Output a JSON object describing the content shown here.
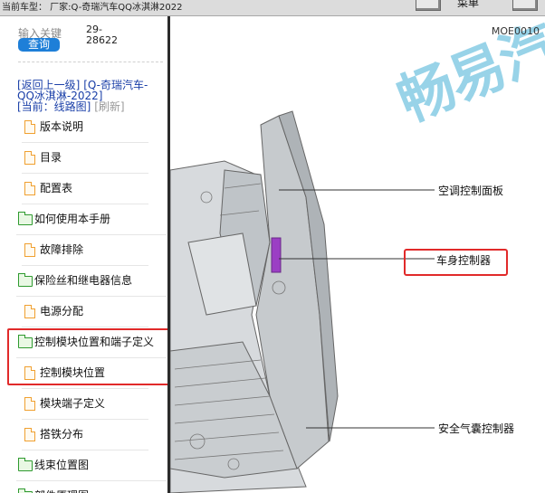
{
  "topbar": {
    "current_model": "当前车型：  厂家:Q-奇瑞汽车QQ冰淇淋2022",
    "right_label": "菜单"
  },
  "sidebar": {
    "search_placeholder": "输入关键",
    "query_button": "查询",
    "code_text": "29-28622",
    "back_link": "[返回上一级]",
    "parent_title": "[Q-奇瑞汽车-QQ冰淇淋-2022]",
    "current_label": "[当前：线路图]",
    "refresh_link": "[刷新]",
    "items": [
      {
        "label": "版本说明",
        "type": "file"
      },
      {
        "label": "目录",
        "type": "file"
      },
      {
        "label": "配置表",
        "type": "file"
      },
      {
        "label": "如何使用本手册",
        "type": "folder"
      },
      {
        "label": "故障排除",
        "type": "file"
      },
      {
        "label": "保险丝和继电器信息",
        "type": "folder"
      },
      {
        "label": "电源分配",
        "type": "file"
      },
      {
        "label": "控制模块位置和端子定义",
        "type": "folder"
      },
      {
        "label": "控制模块位置",
        "type": "file"
      },
      {
        "label": "模块端子定义",
        "type": "file"
      },
      {
        "label": "搭铁分布",
        "type": "file"
      },
      {
        "label": "线束位置图",
        "type": "folder"
      },
      {
        "label": "部件原理图",
        "type": "folder"
      }
    ]
  },
  "diagram": {
    "figure_code": "MOE0010",
    "watermark": "畅易汽",
    "callouts": [
      {
        "label": "空调控制面板"
      },
      {
        "label": "车身控制器",
        "highlighted": true
      },
      {
        "label": "安全气囊控制器"
      }
    ],
    "colors": {
      "highlight": "#e12a2a",
      "link": "#1a3fa8",
      "button": "#1e7fd8",
      "watermark": "#7fc9e3",
      "module": "#9b3fc4"
    }
  }
}
